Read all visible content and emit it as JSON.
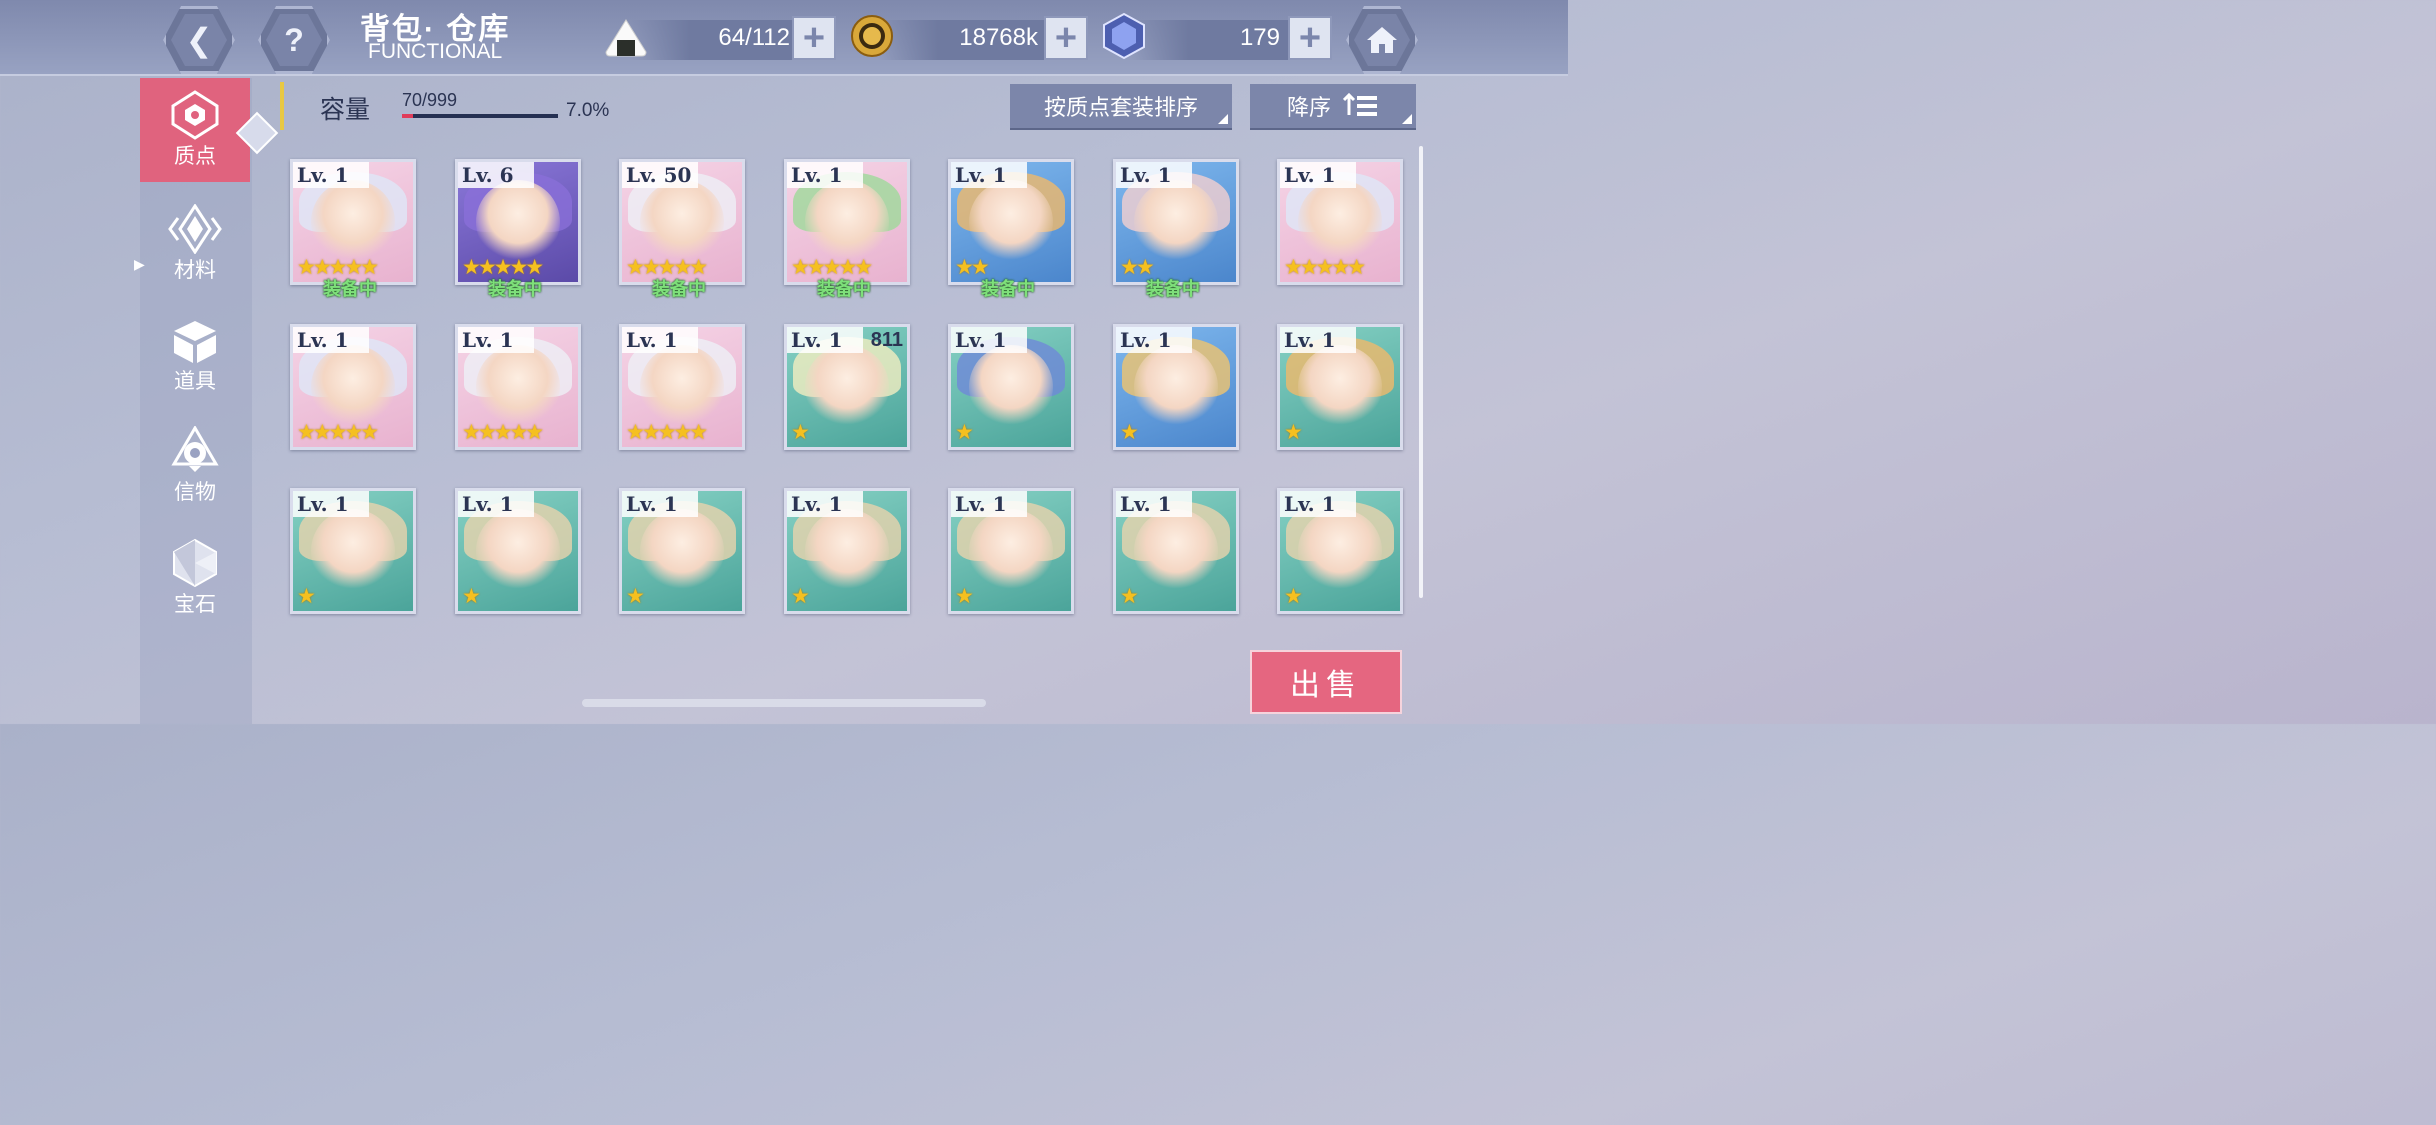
{
  "header": {
    "title_cn": "背包· 仓库",
    "title_en": "FUNCTIONAL",
    "back_icon": "back-arrow-icon",
    "help_icon": "question-icon",
    "home_icon": "home-icon",
    "resources": [
      {
        "icon": "rice-ball-icon",
        "value": "64/112",
        "plus": "+"
      },
      {
        "icon": "coin-icon",
        "value": "18768k",
        "plus": "+"
      },
      {
        "icon": "crystal-icon",
        "value": "179",
        "plus": "+"
      }
    ]
  },
  "sidebar": {
    "items": [
      {
        "label": "质点",
        "icon": "core-icon",
        "active": true
      },
      {
        "label": "材料",
        "icon": "material-icon",
        "active": false
      },
      {
        "label": "道具",
        "icon": "box-icon",
        "active": false
      },
      {
        "label": "信物",
        "icon": "token-icon",
        "active": false
      },
      {
        "label": "宝石",
        "icon": "gem-icon",
        "active": false
      }
    ]
  },
  "capacity": {
    "label": "容量",
    "count": "70/999",
    "percent": "7.0%",
    "fill_fraction": 0.07
  },
  "sort": {
    "by_label": "按质点套装排序",
    "order_label": "降序"
  },
  "equipped_label": "装备中",
  "grid": [
    {
      "level": "Lv. 1",
      "stars": 5,
      "color": "pink",
      "hair": "#dfe7f7",
      "equipped": true
    },
    {
      "level": "Lv. 6",
      "stars": 5,
      "color": "purple",
      "hair": "#8a6fd8",
      "equipped": true
    },
    {
      "level": "Lv. 50",
      "stars": 5,
      "color": "pink",
      "hair": "#eef0f6",
      "equipped": true
    },
    {
      "level": "Lv. 1",
      "stars": 5,
      "color": "pink",
      "hair": "#9ed99a",
      "equipped": true
    },
    {
      "level": "Lv. 1",
      "stars": 2,
      "color": "blue",
      "hair": "#f0b96a",
      "equipped": true
    },
    {
      "level": "Lv. 1",
      "stars": 2,
      "color": "blue",
      "hair": "#f4cfcf",
      "equipped": true
    },
    {
      "level": "Lv. 1",
      "stars": 5,
      "color": "pink",
      "hair": "#dfe7f7",
      "equipped": false
    },
    {
      "level": "Lv. 1",
      "stars": 5,
      "color": "pink",
      "hair": "#dfe7f7",
      "equipped": false
    },
    {
      "level": "Lv. 1",
      "stars": 5,
      "color": "pink",
      "hair": "#eef0f6",
      "equipped": false
    },
    {
      "level": "Lv. 1",
      "stars": 5,
      "color": "pink",
      "hair": "#eef0f6",
      "equipped": false
    },
    {
      "level": "Lv. 1",
      "stars": 1,
      "color": "teal",
      "hair": "#f3eec0",
      "equipped": false,
      "qty": "811"
    },
    {
      "level": "Lv. 1",
      "stars": 1,
      "color": "teal",
      "hair": "#6f88d8",
      "equipped": false
    },
    {
      "level": "Lv. 1",
      "stars": 1,
      "color": "blue",
      "hair": "#f0c46e",
      "equipped": false
    },
    {
      "level": "Lv. 1",
      "stars": 1,
      "color": "teal",
      "hair": "#f0b96a",
      "equipped": false
    },
    {
      "level": "Lv. 1",
      "stars": 1,
      "color": "teal",
      "hair": "#e8d3ad",
      "equipped": false
    },
    {
      "level": "Lv. 1",
      "stars": 1,
      "color": "teal",
      "hair": "#e8d3ad",
      "equipped": false
    },
    {
      "level": "Lv. 1",
      "stars": 1,
      "color": "teal",
      "hair": "#e8d3ad",
      "equipped": false
    },
    {
      "level": "Lv. 1",
      "stars": 1,
      "color": "teal",
      "hair": "#e8d3ad",
      "equipped": false
    },
    {
      "level": "Lv. 1",
      "stars": 1,
      "color": "teal",
      "hair": "#e8d3ad",
      "equipped": false
    },
    {
      "level": "Lv. 1",
      "stars": 1,
      "color": "teal",
      "hair": "#e8d3ad",
      "equipped": false
    },
    {
      "level": "Lv. 1",
      "stars": 1,
      "color": "teal",
      "hair": "#e8d3ad",
      "equipped": false
    }
  ],
  "sell_label": "出售"
}
